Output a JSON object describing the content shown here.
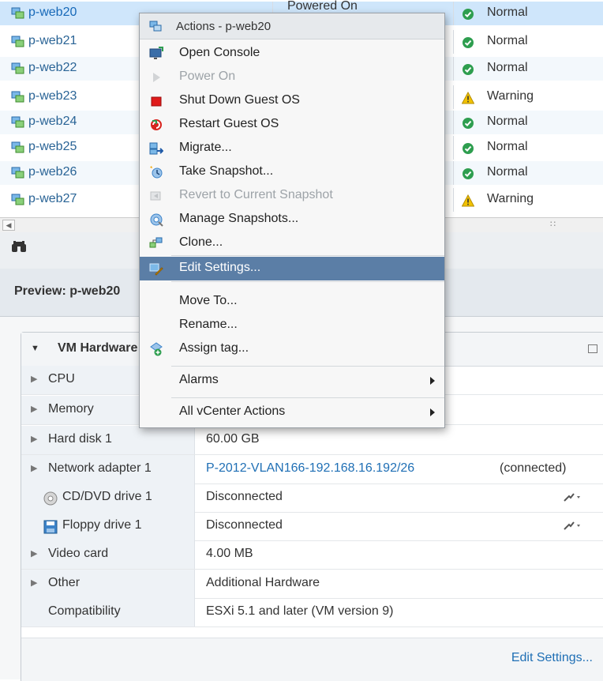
{
  "vm_list": {
    "rows": [
      {
        "name": "p-web20",
        "power": "Powered On",
        "status": "Normal",
        "status_kind": "ok"
      },
      {
        "name": "p-web21",
        "power": "",
        "status": "Normal",
        "status_kind": "ok"
      },
      {
        "name": "p-web22",
        "power": "",
        "status": "Normal",
        "status_kind": "ok"
      },
      {
        "name": "p-web23",
        "power": "",
        "status": "Warning",
        "status_kind": "warn"
      },
      {
        "name": "p-web24",
        "power": "",
        "status": "Normal",
        "status_kind": "ok"
      },
      {
        "name": "p-web25",
        "power": "",
        "status": "Normal",
        "status_kind": "ok"
      },
      {
        "name": "p-web26",
        "power": "",
        "status": "Normal",
        "status_kind": "ok"
      },
      {
        "name": "p-web27",
        "power": "",
        "status": "Warning",
        "status_kind": "warn"
      }
    ]
  },
  "preview": {
    "title": "Preview: p-web20"
  },
  "hardware_panel": {
    "title": "VM Hardware",
    "rows": [
      {
        "label": "CPU",
        "value": "",
        "extra": ""
      },
      {
        "label": "Memory",
        "value": "",
        "extra": ""
      },
      {
        "label": "Hard disk 1",
        "value": "60.00 GB",
        "extra": ""
      },
      {
        "label": "Network adapter 1",
        "value": "P-2012-VLAN166-192.168.16.192/26",
        "extra": "(connected)"
      },
      {
        "label": "CD/DVD drive 1",
        "value": "Disconnected",
        "extra": ""
      },
      {
        "label": "Floppy drive 1",
        "value": "Disconnected",
        "extra": ""
      },
      {
        "label": "Video card",
        "value": "4.00 MB",
        "extra": ""
      },
      {
        "label": "Other",
        "value": "Additional Hardware",
        "extra": ""
      },
      {
        "label": "Compatibility",
        "value": "ESXi 5.1 and later (VM version 9)",
        "extra": ""
      }
    ],
    "footer_link": "Edit Settings..."
  },
  "context_menu": {
    "header": "Actions - p-web20",
    "items": [
      {
        "label": "Open Console",
        "icon": "console-icon",
        "disabled": false
      },
      {
        "label": "Power On",
        "icon": "power-on-icon",
        "disabled": true
      },
      {
        "label": "Shut Down Guest OS",
        "icon": "shutdown-icon",
        "disabled": false
      },
      {
        "label": "Restart Guest OS",
        "icon": "restart-icon",
        "disabled": false
      },
      {
        "label": "Migrate...",
        "icon": "migrate-icon",
        "disabled": false
      },
      {
        "label": "Take Snapshot...",
        "icon": "take-snapshot-icon",
        "disabled": false
      },
      {
        "label": "Revert to Current Snapshot",
        "icon": "revert-snapshot-icon",
        "disabled": true
      },
      {
        "label": "Manage Snapshots...",
        "icon": "manage-snapshots-icon",
        "disabled": false
      },
      {
        "label": "Clone...",
        "icon": "clone-icon",
        "disabled": false
      },
      {
        "label": "Edit Settings...",
        "icon": "edit-settings-icon",
        "disabled": false,
        "hovered": true
      },
      {
        "label": "Move To...",
        "icon": "",
        "disabled": false
      },
      {
        "label": "Rename...",
        "icon": "",
        "disabled": false
      },
      {
        "label": "Assign tag...",
        "icon": "assign-tag-icon",
        "disabled": false
      },
      {
        "label": "Alarms",
        "icon": "",
        "disabled": false,
        "submenu": true
      },
      {
        "label": "All vCenter Actions",
        "icon": "",
        "disabled": false,
        "submenu": true
      }
    ]
  },
  "colors": {
    "selected_row": "#cfe6fb",
    "menu_hover": "#5b7ea6",
    "link": "#1f6fb5",
    "ok_green": "#2e9e4f",
    "warn_yellow": "#f2c200"
  }
}
